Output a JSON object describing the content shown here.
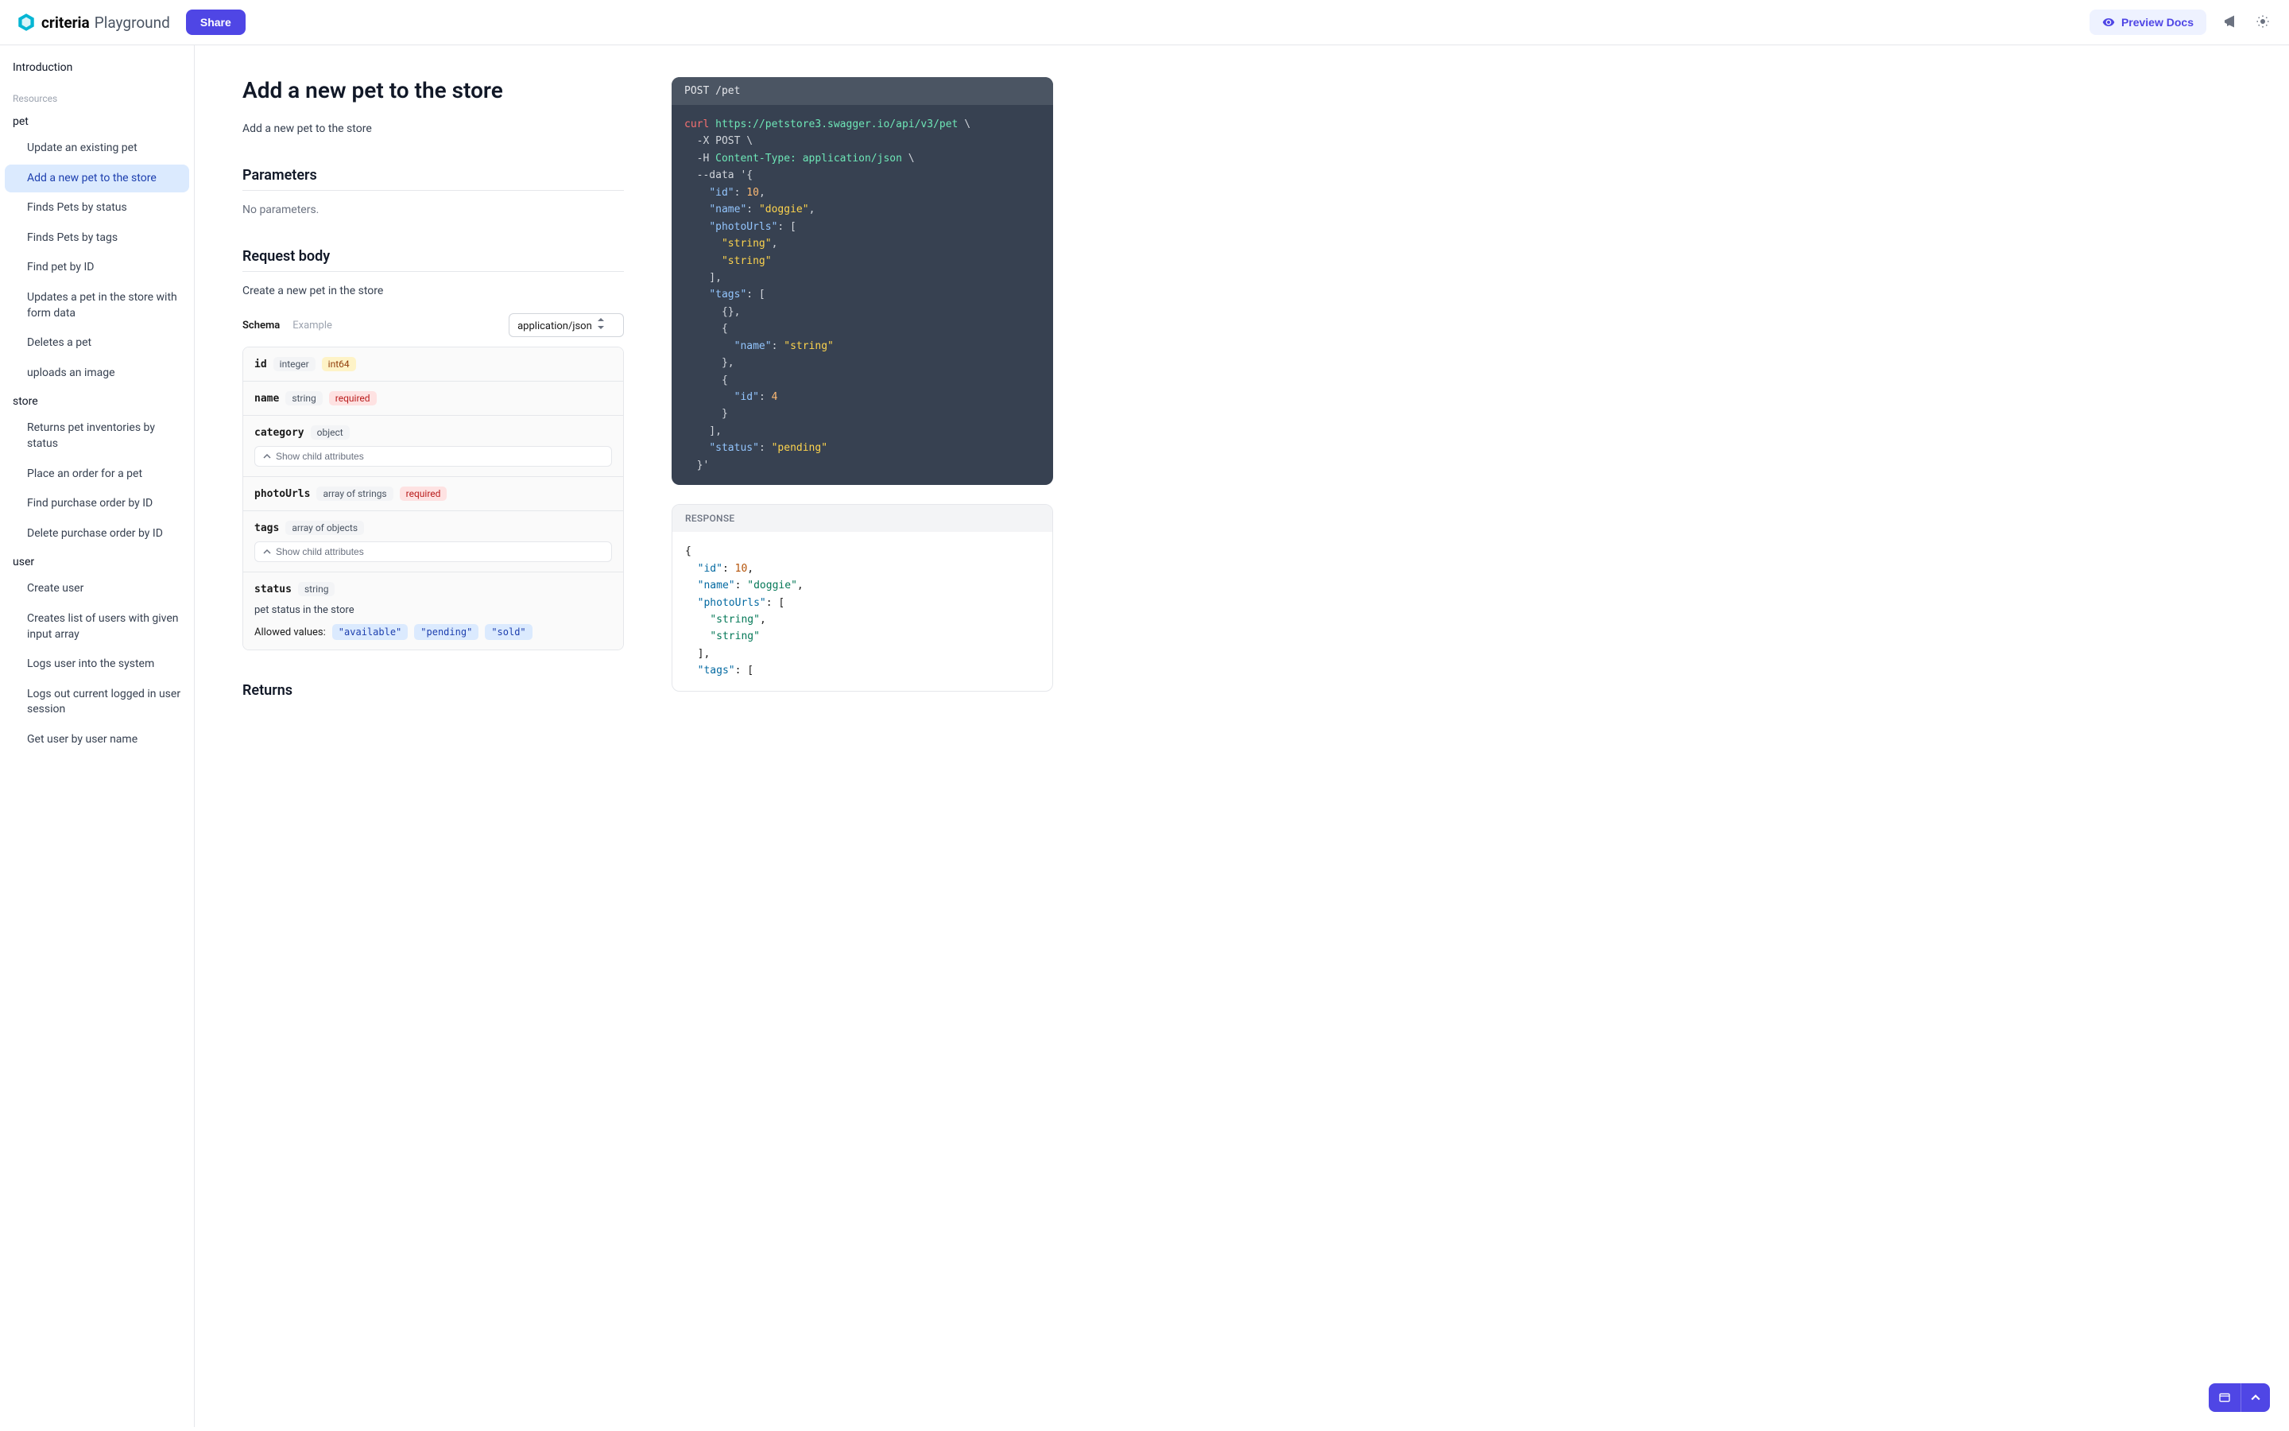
{
  "header": {
    "logo_text": "criteria",
    "logo_sub": "Playground",
    "share_label": "Share",
    "preview_label": "Preview Docs"
  },
  "sidebar": {
    "intro_label": "Introduction",
    "resources_label": "Resources",
    "groups": [
      {
        "name": "pet",
        "items": [
          "Update an existing pet",
          "Add a new pet to the store",
          "Finds Pets by status",
          "Finds Pets by tags",
          "Find pet by ID",
          "Updates a pet in the store with form data",
          "Deletes a pet",
          "uploads an image"
        ]
      },
      {
        "name": "store",
        "items": [
          "Returns pet inventories by status",
          "Place an order for a pet",
          "Find purchase order by ID",
          "Delete purchase order by ID"
        ]
      },
      {
        "name": "user",
        "items": [
          "Create user",
          "Creates list of users with given input array",
          "Logs user into the system",
          "Logs out current logged in user session",
          "Get user by user name"
        ]
      }
    ]
  },
  "main": {
    "title": "Add a new pet to the store",
    "description": "Add a new pet to the store",
    "parameters_heading": "Parameters",
    "no_parameters": "No parameters.",
    "request_body_heading": "Request body",
    "request_body_desc": "Create a new pet in the store",
    "tab_schema": "Schema",
    "tab_example": "Example",
    "content_type": "application/json",
    "expand_label": "Show child attributes",
    "allowed_label": "Allowed values:",
    "returns_heading": "Returns",
    "fields": [
      {
        "name": "id",
        "type": "integer",
        "format": "int64"
      },
      {
        "name": "name",
        "type": "string",
        "required": true
      },
      {
        "name": "category",
        "type": "object",
        "expandable": true
      },
      {
        "name": "photoUrls",
        "type": "array of strings",
        "required": true
      },
      {
        "name": "tags",
        "type": "array of objects",
        "expandable": true
      },
      {
        "name": "status",
        "type": "string",
        "desc": "pet status in the store",
        "allowed": [
          "\"available\"",
          "\"pending\"",
          "\"sold\""
        ]
      }
    ]
  },
  "code": {
    "header": "POST /pet",
    "curl": "curl",
    "url": "https://petstore3.swagger.io/api/v3/pet",
    "method_flag": "-X POST",
    "header_flag": "-H",
    "header_val": "Content-Type: application/json",
    "data_flag": "--data"
  },
  "response": {
    "label": "RESPONSE"
  }
}
